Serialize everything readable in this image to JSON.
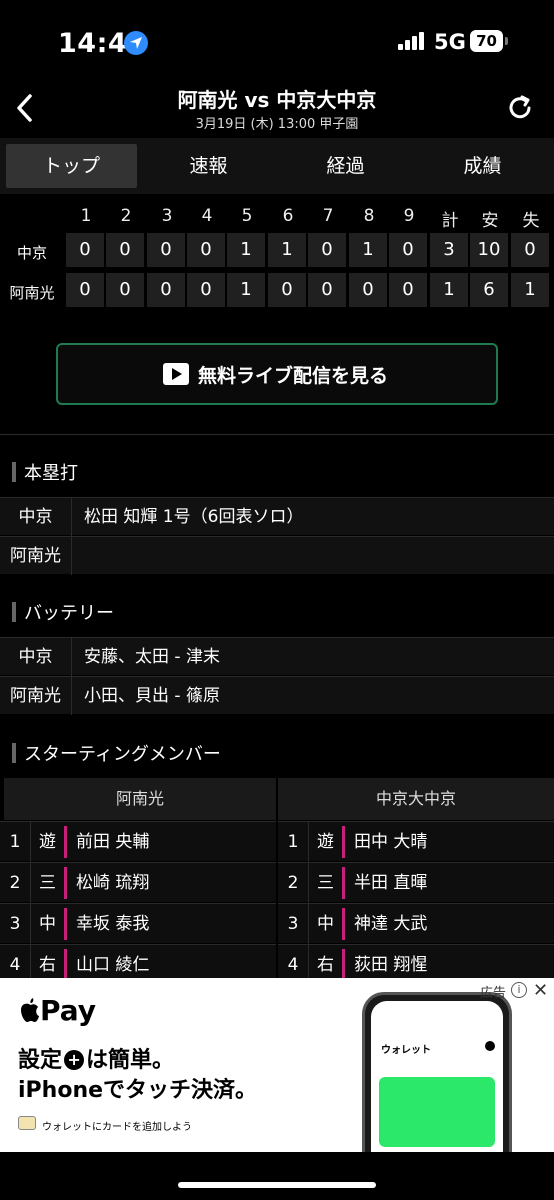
{
  "status": {
    "time": "14:42",
    "network": "5G",
    "battery": "70"
  },
  "header": {
    "title": "阿南光 vs 中京大中京",
    "subtitle": "3月19日 (木) 13:00 甲子園"
  },
  "tabs": [
    "トップ",
    "速報",
    "経過",
    "成績"
  ],
  "scoreboard": {
    "columns": [
      "1",
      "2",
      "3",
      "4",
      "5",
      "6",
      "7",
      "8",
      "9",
      "計",
      "安",
      "失"
    ],
    "rows": [
      {
        "team": "中京",
        "cells": [
          "0",
          "0",
          "0",
          "0",
          "1",
          "1",
          "0",
          "1",
          "0",
          "3",
          "10",
          "0"
        ]
      },
      {
        "team": "阿南光",
        "cells": [
          "0",
          "0",
          "0",
          "0",
          "1",
          "0",
          "0",
          "0",
          "0",
          "1",
          "6",
          "1"
        ]
      }
    ]
  },
  "live_button": "無料ライブ配信を見る",
  "homerun": {
    "title": "本塁打",
    "rows": [
      {
        "team": "中京",
        "value": "松田 知輝 1号（6回表ソロ）"
      },
      {
        "team": "阿南光",
        "value": ""
      }
    ]
  },
  "battery": {
    "title": "バッテリー",
    "rows": [
      {
        "team": "中京",
        "value": "安藤、太田 - 津末"
      },
      {
        "team": "阿南光",
        "value": "小田、貝出 - 篠原"
      }
    ]
  },
  "lineup": {
    "title": "スターティングメンバー",
    "left_team": "阿南光",
    "right_team": "中京大中京",
    "left": [
      {
        "num": "1",
        "pos": "遊",
        "name": "前田 央輔"
      },
      {
        "num": "2",
        "pos": "三",
        "name": "松崎 琉翔"
      },
      {
        "num": "3",
        "pos": "中",
        "name": "幸坂 泰我"
      },
      {
        "num": "4",
        "pos": "右",
        "name": "山口 綾仁"
      }
    ],
    "right": [
      {
        "num": "1",
        "pos": "遊",
        "name": "田中 大晴"
      },
      {
        "num": "2",
        "pos": "三",
        "name": "半田 直暉"
      },
      {
        "num": "3",
        "pos": "中",
        "name": "神達 大武"
      },
      {
        "num": "4",
        "pos": "右",
        "name": "荻田 翔惺"
      }
    ]
  },
  "ad": {
    "tag": "広告",
    "pay": "Pay",
    "line1a": "設定",
    "line1b": "は簡単。",
    "line2": "iPhoneでタッチ決済。",
    "small": "ウォレットにカードを追加しよう",
    "phone_label": "ウォレット"
  }
}
